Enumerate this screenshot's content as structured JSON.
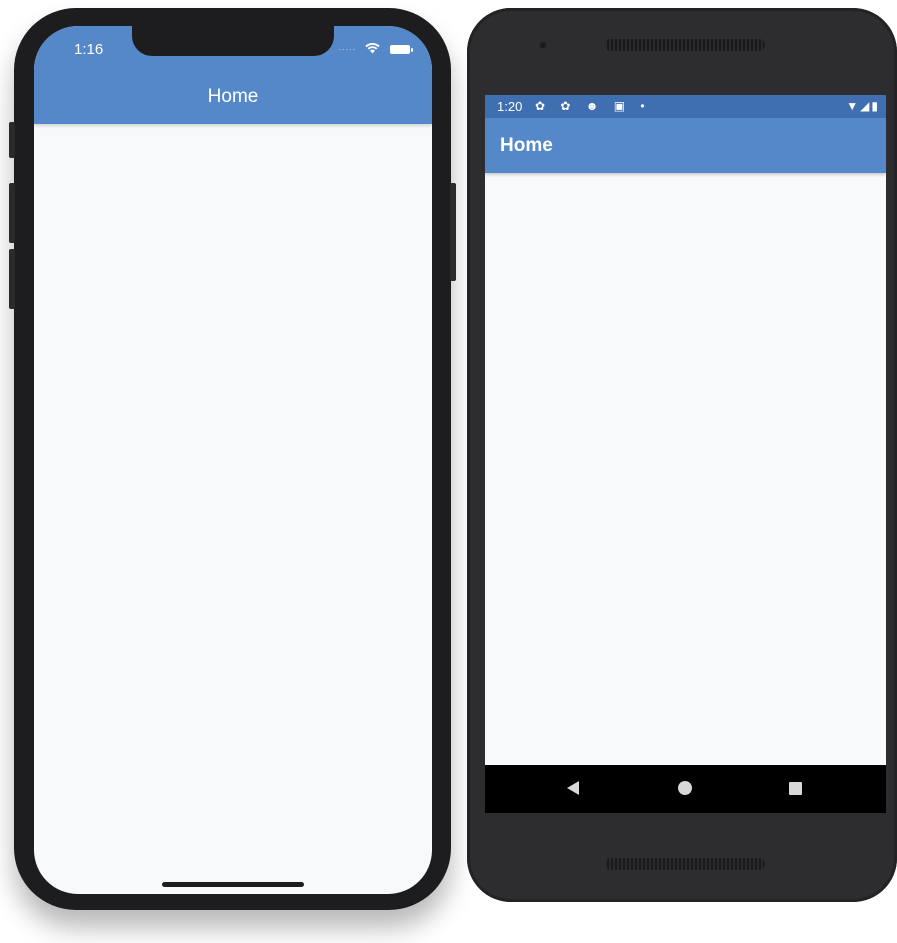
{
  "ios": {
    "status_time": "1:16",
    "status_dots": ".....",
    "title": "Home",
    "icons": {
      "wifi": "wifi-icon",
      "battery": "battery-icon"
    }
  },
  "android": {
    "status_time": "1:20",
    "status_left_icons": "✿ ✿ ☻ ▣ •",
    "status_right_icons": "▼◢▮",
    "title": "Home",
    "icons": {
      "back": "back-icon",
      "home": "home-icon",
      "recents": "recents-icon"
    }
  },
  "colors": {
    "appbar": "#5488c8",
    "android_status": "#3f6fb0",
    "background": "#f8f9fb",
    "device": "#1d1d1f"
  }
}
